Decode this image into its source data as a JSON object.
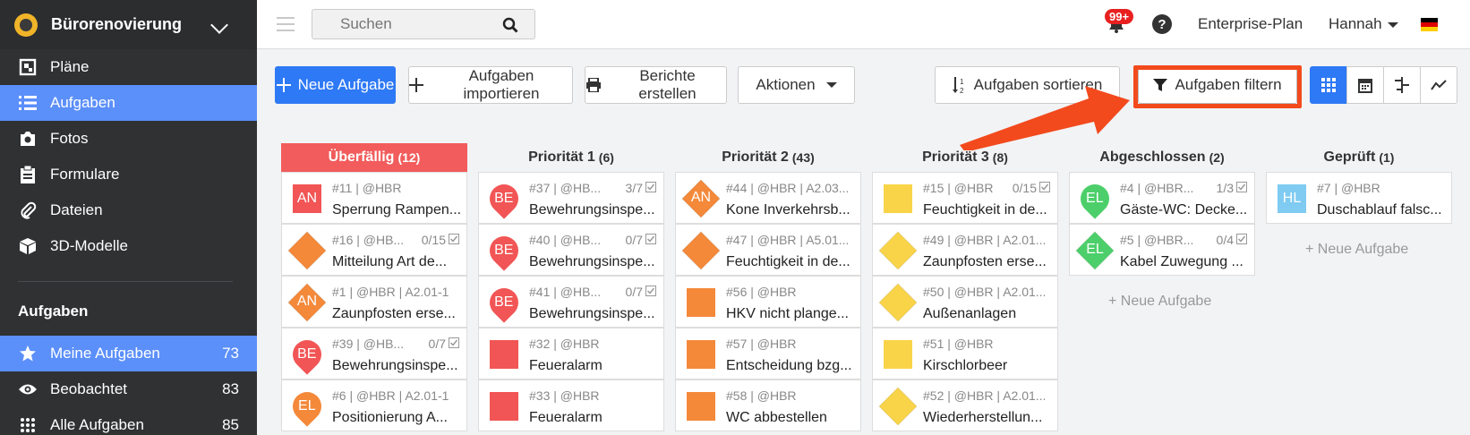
{
  "project": {
    "name": "Bürorenovierung"
  },
  "sidebar": {
    "items": [
      {
        "label": "Pläne",
        "icon": "plans-icon"
      },
      {
        "label": "Aufgaben",
        "icon": "list-icon"
      },
      {
        "label": "Fotos",
        "icon": "camera-icon"
      },
      {
        "label": "Formulare",
        "icon": "clipboard-icon"
      },
      {
        "label": "Dateien",
        "icon": "paperclip-icon"
      },
      {
        "label": "3D-Modelle",
        "icon": "cube-icon"
      }
    ],
    "section_title": "Aufgaben",
    "filters": [
      {
        "label": "Meine Aufgaben",
        "count": "73",
        "icon": "star-icon"
      },
      {
        "label": "Beobachtet",
        "count": "83",
        "icon": "eye-icon"
      },
      {
        "label": "Alle Aufgaben",
        "count": "85",
        "icon": "grid-dots-icon"
      }
    ]
  },
  "topbar": {
    "search_placeholder": "Suchen",
    "notifications_badge": "99+",
    "help": "?",
    "plan": "Enterprise-Plan",
    "user": "Hannah"
  },
  "toolbar": {
    "new_task": "Neue Aufgabe",
    "import": "Aufgaben importieren",
    "reports": "Berichte erstellen",
    "actions": "Aktionen",
    "sort": "Aufgaben sortieren",
    "filter": "Aufgaben filtern"
  },
  "columns": [
    {
      "title": "Überfällig",
      "count": "(12)",
      "cards": [
        {
          "meta": "#11 | @HBR",
          "progress": "",
          "title": "Sperrung Rampen...",
          "avatar": "AN",
          "shape": "square",
          "color": "#f25555"
        },
        {
          "meta": "#16 | @HB...",
          "progress": "0/15",
          "title": "Mitteilung Art de...",
          "avatar": "",
          "shape": "diamond",
          "color": "#f4893a"
        },
        {
          "meta": "#1 | @HBR | A2.01-1",
          "progress": "",
          "title": "Zaunpfosten erse...",
          "avatar": "AN",
          "shape": "diamond",
          "color": "#f4893a"
        },
        {
          "meta": "#39 | @HB...",
          "progress": "0/7",
          "title": "Bewehrungsinspe...",
          "avatar": "BE",
          "shape": "pin",
          "color": "#f25555"
        },
        {
          "meta": "#6 | @HBR | A2.01-1",
          "progress": "",
          "title": "Positionierung A...",
          "avatar": "EL",
          "shape": "pin",
          "color": "#f4893a"
        }
      ]
    },
    {
      "title": "Priorität 1",
      "count": "(6)",
      "cards": [
        {
          "meta": "#37 | @HB...",
          "progress": "3/7",
          "title": "Bewehrungsinspe...",
          "avatar": "BE",
          "shape": "pin",
          "color": "#f25555"
        },
        {
          "meta": "#40 | @HB...",
          "progress": "0/7",
          "title": "Bewehrungsinspe...",
          "avatar": "BE",
          "shape": "pin",
          "color": "#f25555"
        },
        {
          "meta": "#41 | @HB...",
          "progress": "0/7",
          "title": "Bewehrungsinspe...",
          "avatar": "BE",
          "shape": "pin",
          "color": "#f25555"
        },
        {
          "meta": "#32 | @HBR",
          "progress": "",
          "title": "Feueralarm",
          "avatar": "",
          "shape": "square",
          "color": "#f25555"
        },
        {
          "meta": "#33 | @HBR",
          "progress": "",
          "title": "Feueralarm",
          "avatar": "",
          "shape": "square",
          "color": "#f25555"
        }
      ]
    },
    {
      "title": "Priorität 2",
      "count": "(43)",
      "cards": [
        {
          "meta": "#44 | @HBR | A2.03...",
          "progress": "",
          "title": "Kone Inverkehrsb...",
          "avatar": "AN",
          "shape": "diamond",
          "color": "#f4893a"
        },
        {
          "meta": "#47 | @HBR | A5.01...",
          "progress": "",
          "title": "Feuchtigkeit in de...",
          "avatar": "",
          "shape": "diamond",
          "color": "#f4893a"
        },
        {
          "meta": "#56 | @HBR",
          "progress": "",
          "title": "HKV nicht plange...",
          "avatar": "",
          "shape": "square",
          "color": "#f4893a"
        },
        {
          "meta": "#57 | @HBR",
          "progress": "",
          "title": "Entscheidung bzg...",
          "avatar": "",
          "shape": "square",
          "color": "#f4893a"
        },
        {
          "meta": "#58 | @HBR",
          "progress": "",
          "title": "WC abbestellen",
          "avatar": "",
          "shape": "square",
          "color": "#f4893a"
        }
      ]
    },
    {
      "title": "Priorität 3",
      "count": "(8)",
      "cards": [
        {
          "meta": "#15 | @HBR",
          "progress": "0/15",
          "title": "Feuchtigkeit in de...",
          "avatar": "",
          "shape": "square",
          "color": "#f9d448"
        },
        {
          "meta": "#49 | @HBR | A2.01...",
          "progress": "",
          "title": "Zaunpfosten erse...",
          "avatar": "",
          "shape": "diamond",
          "color": "#f9d448"
        },
        {
          "meta": "#50 | @HBR | A2.01...",
          "progress": "",
          "title": "Außenanlagen",
          "avatar": "",
          "shape": "diamond",
          "color": "#f9d448"
        },
        {
          "meta": "#51 | @HBR",
          "progress": "",
          "title": "Kirschlorbeer",
          "avatar": "",
          "shape": "square",
          "color": "#f9d448"
        },
        {
          "meta": "#52 | @HBR | A2.01...",
          "progress": "",
          "title": "Wiederherstellun...",
          "avatar": "",
          "shape": "diamond",
          "color": "#f9d448"
        }
      ]
    },
    {
      "title": "Abgeschlossen",
      "count": "(2)",
      "new_task": "+ Neue Aufgabe",
      "cards": [
        {
          "meta": "#4 | @HBR...",
          "progress": "1/3",
          "title": "Gäste-WC: Decke...",
          "avatar": "EL",
          "shape": "pin",
          "color": "#4ccf6a"
        },
        {
          "meta": "#5 | @HBR...",
          "progress": "0/4",
          "title": "Kabel Zuwegung ...",
          "avatar": "EL",
          "shape": "diamond",
          "color": "#4ccf6a"
        }
      ]
    },
    {
      "title": "Geprüft",
      "count": "(1)",
      "new_task": "+ Neue Aufgabe",
      "cards": [
        {
          "meta": "#7 | @HBR",
          "progress": "",
          "title": "Duschablauf falsc...",
          "avatar": "HL",
          "shape": "square",
          "color": "#7fcbf2"
        }
      ]
    }
  ]
}
